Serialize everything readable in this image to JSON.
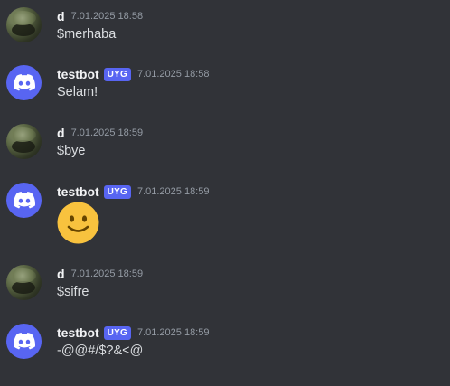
{
  "messages": [
    {
      "author": "d",
      "tag": "",
      "timestamp": "7.01.2025 18:58",
      "text": "$merhaba",
      "avatar": "user-photo"
    },
    {
      "author": "testbot",
      "tag": "UYG",
      "timestamp": "7.01.2025 18:58",
      "text": "Selam!",
      "avatar": "discord-logo-icon"
    },
    {
      "author": "d",
      "tag": "",
      "timestamp": "7.01.2025 18:59",
      "text": "$bye",
      "avatar": "user-photo"
    },
    {
      "author": "testbot",
      "tag": "UYG",
      "timestamp": "7.01.2025 18:59",
      "text": "",
      "emoji": "slightly-smiling-face-emoji",
      "avatar": "discord-logo-icon"
    },
    {
      "author": "d",
      "tag": "",
      "timestamp": "7.01.2025 18:59",
      "text": "$sifre",
      "avatar": "user-photo"
    },
    {
      "author": "testbot",
      "tag": "UYG",
      "timestamp": "7.01.2025 18:59",
      "text": "-@@#/$?&<@",
      "avatar": "discord-logo-icon"
    }
  ],
  "colors": {
    "background": "#313338",
    "brand": "#5865f2",
    "username": "#f2f3f5",
    "message_text": "#dbdee1",
    "timestamp": "#949ba4",
    "emoji": "#f8c23e"
  }
}
